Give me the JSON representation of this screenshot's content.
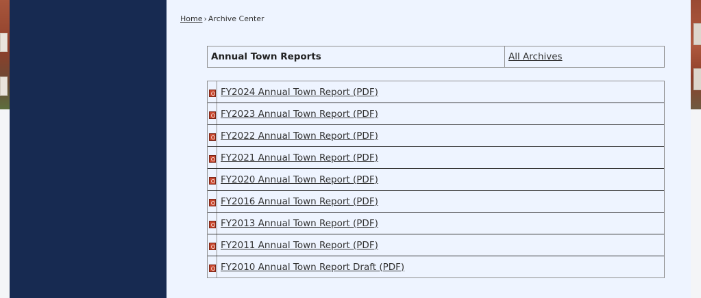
{
  "breadcrumb": {
    "home": "Home",
    "separator": "›",
    "current": "Archive Center"
  },
  "archive": {
    "title": "Annual Town Reports",
    "all_archives": "All Archives",
    "icon": "pdf-icon",
    "items": [
      "FY2024 Annual Town Report (PDF)",
      "FY2023 Annual Town Report (PDF)",
      "FY2022 Annual Town Report (PDF)",
      "FY2021 Annual Town Report (PDF)",
      "FY2020 Annual Town Report (PDF)",
      "FY2016 Annual Town Report (PDF)",
      "FY2013 Annual Town Report (PDF)",
      "FY2011 Annual Town Report (PDF)",
      "FY2010 Annual Town Report Draft (PDF)"
    ]
  },
  "colors": {
    "sidebar": "#172a51",
    "content_background": "#eef4ff",
    "text": "#333333",
    "pdf_icon": "#c8482f"
  }
}
